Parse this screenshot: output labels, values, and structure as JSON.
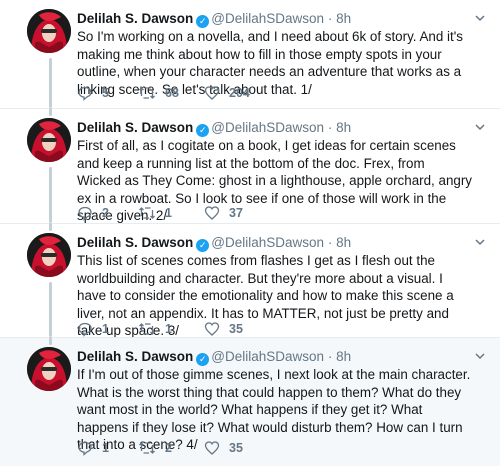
{
  "tweets": [
    {
      "name": "Delilah S. Dawson",
      "handle": "@DelilahSDawson",
      "separator": "·",
      "time": "8h",
      "text": "So I'm working on a novella, and I need about 6k of story. And it's making me think about how to fill in those empty spots in your outline, when your character needs an adventure that works as a linking scene. So let's talk about that. 1/",
      "replies": "5",
      "retweets": "68",
      "likes": "204",
      "highlighted": false
    },
    {
      "name": "Delilah S. Dawson",
      "handle": "@DelilahSDawson",
      "separator": "·",
      "time": "8h",
      "text": "First of all, as I cogitate on a book, I get ideas for certain scenes and keep a running list at the bottom of the doc. Frex, from Wicked as They Come: ghost in a lighthouse, apple orchard, angry ex in a rowboat. So I look to see if one of those will work in the space given. 2/",
      "replies": "2",
      "retweets": "1",
      "likes": "37",
      "highlighted": false
    },
    {
      "name": "Delilah S. Dawson",
      "handle": "@DelilahSDawson",
      "separator": "·",
      "time": "8h",
      "text": "This list of scenes comes from flashes I get as I flesh out the worldbuilding and character. But they're more about a visual. I have to consider the emotionality and how to make this scene a liver, not an appendix. It has to MATTER, not just be pretty and take up space. 3/",
      "replies": "1",
      "retweets": "1",
      "likes": "35",
      "highlighted": false
    },
    {
      "name": "Delilah S. Dawson",
      "handle": "@DelilahSDawson",
      "separator": "·",
      "time": "8h",
      "text": "If I'm out of those gimme scenes, I next look at the main character. What is the worst thing that could happen to them? What do they want most in the world? What happens if they get it? What happens if they lose it? What would disturb them? How can I turn that into a scene? 4/",
      "replies": "1",
      "retweets": "2",
      "likes": "35",
      "highlighted": true
    }
  ],
  "colors": {
    "verified": "#1da1f2",
    "muted": "#657786",
    "thread_line": "#c4cfd6",
    "highlight_bg": "#f5f8fa"
  },
  "icons": {
    "reply": "reply-icon",
    "retweet": "retweet-icon",
    "like": "heart-icon",
    "menu": "chevron-down-icon",
    "verified": "verified-badge-icon"
  }
}
